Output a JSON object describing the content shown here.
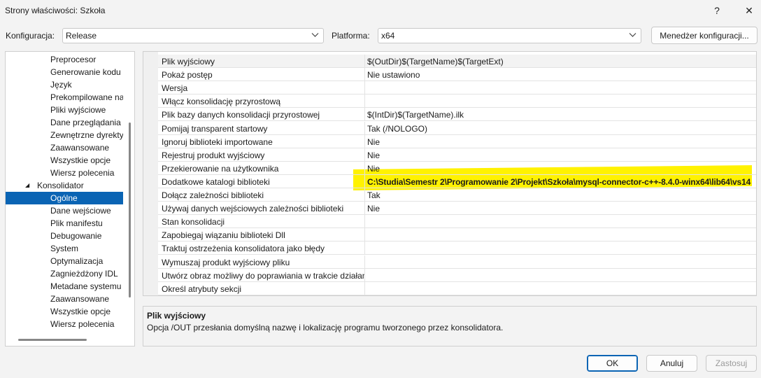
{
  "window": {
    "title": "Strony właściwości: Szkoła",
    "help_glyph": "?",
    "close_glyph": "✕"
  },
  "config_bar": {
    "config_label": "Konfiguracja:",
    "config_value": "Release",
    "platform_label": "Platforma:",
    "platform_value": "x64",
    "manager_button": "Menedżer konfiguracji..."
  },
  "tree": {
    "items": [
      {
        "label": "Preprocesor"
      },
      {
        "label": "Generowanie kodu"
      },
      {
        "label": "Język"
      },
      {
        "label": "Prekompilowane na"
      },
      {
        "label": "Pliki wyjściowe"
      },
      {
        "label": "Dane przeglądania"
      },
      {
        "label": "Zewnętrzne dyrekty"
      },
      {
        "label": "Zaawansowane"
      },
      {
        "label": "Wszystkie opcje"
      },
      {
        "label": "Wiersz polecenia"
      },
      {
        "label": "Konsolidator",
        "expander": "◢"
      },
      {
        "label": "Ogólne"
      },
      {
        "label": "Dane wejściowe"
      },
      {
        "label": "Plik manifestu"
      },
      {
        "label": "Debugowanie"
      },
      {
        "label": "System"
      },
      {
        "label": "Optymalizacja"
      },
      {
        "label": "Zagnieżdżony IDL"
      },
      {
        "label": "Metadane systemu"
      },
      {
        "label": "Zaawansowane"
      },
      {
        "label": "Wszystkie opcje"
      },
      {
        "label": "Wiersz polecenia"
      }
    ],
    "selected": "Ogólne"
  },
  "properties": [
    {
      "name": "Plik wyjściowy",
      "value": "$(OutDir)$(TargetName)$(TargetExt)"
    },
    {
      "name": "Pokaż postęp",
      "value": "Nie ustawiono"
    },
    {
      "name": "Wersja",
      "value": ""
    },
    {
      "name": "Włącz konsolidację przyrostową",
      "value": ""
    },
    {
      "name": "Plik bazy danych konsolidacji przyrostowej",
      "value": "$(IntDir)$(TargetName).ilk"
    },
    {
      "name": "Pomijaj transparent startowy",
      "value": "Tak (/NOLOGO)"
    },
    {
      "name": "Ignoruj biblioteki importowane",
      "value": "Nie"
    },
    {
      "name": "Rejestruj produkt wyjściowy",
      "value": "Nie"
    },
    {
      "name": "Przekierowanie na użytkownika",
      "value": "Nie"
    },
    {
      "name": "Dodatkowe katalogi biblioteki",
      "value": "C:\\Studia\\Semestr 2\\Programowanie 2\\Projekt\\Szkoła\\mysql-connector-c++-8.4.0-winx64\\lib64\\vs14"
    },
    {
      "name": "Dołącz zależności biblioteki",
      "value": "Tak"
    },
    {
      "name": "Używaj danych wejściowych zależności biblioteki",
      "value": "Nie"
    },
    {
      "name": "Stan konsolidacji",
      "value": ""
    },
    {
      "name": "Zapobiegaj wiązaniu biblioteki Dll",
      "value": ""
    },
    {
      "name": "Traktuj ostrzeżenia konsolidatora jako błędy",
      "value": ""
    },
    {
      "name": "Wymuszaj produkt wyjściowy pliku",
      "value": ""
    },
    {
      "name": "Utwórz obraz możliwy do poprawiania w trakcie działania",
      "value": ""
    },
    {
      "name": "Określ atrybuty sekcji",
      "value": ""
    }
  ],
  "highlight_color": "#fff200",
  "selection_color": "#0a64b4",
  "description": {
    "title": "Plik wyjściowy",
    "text": "Opcja /OUT przesłania domyślną nazwę i lokalizację programu tworzonego przez konsolidatora."
  },
  "buttons": {
    "ok": "OK",
    "cancel": "Anuluj",
    "apply": "Zastosuj"
  }
}
